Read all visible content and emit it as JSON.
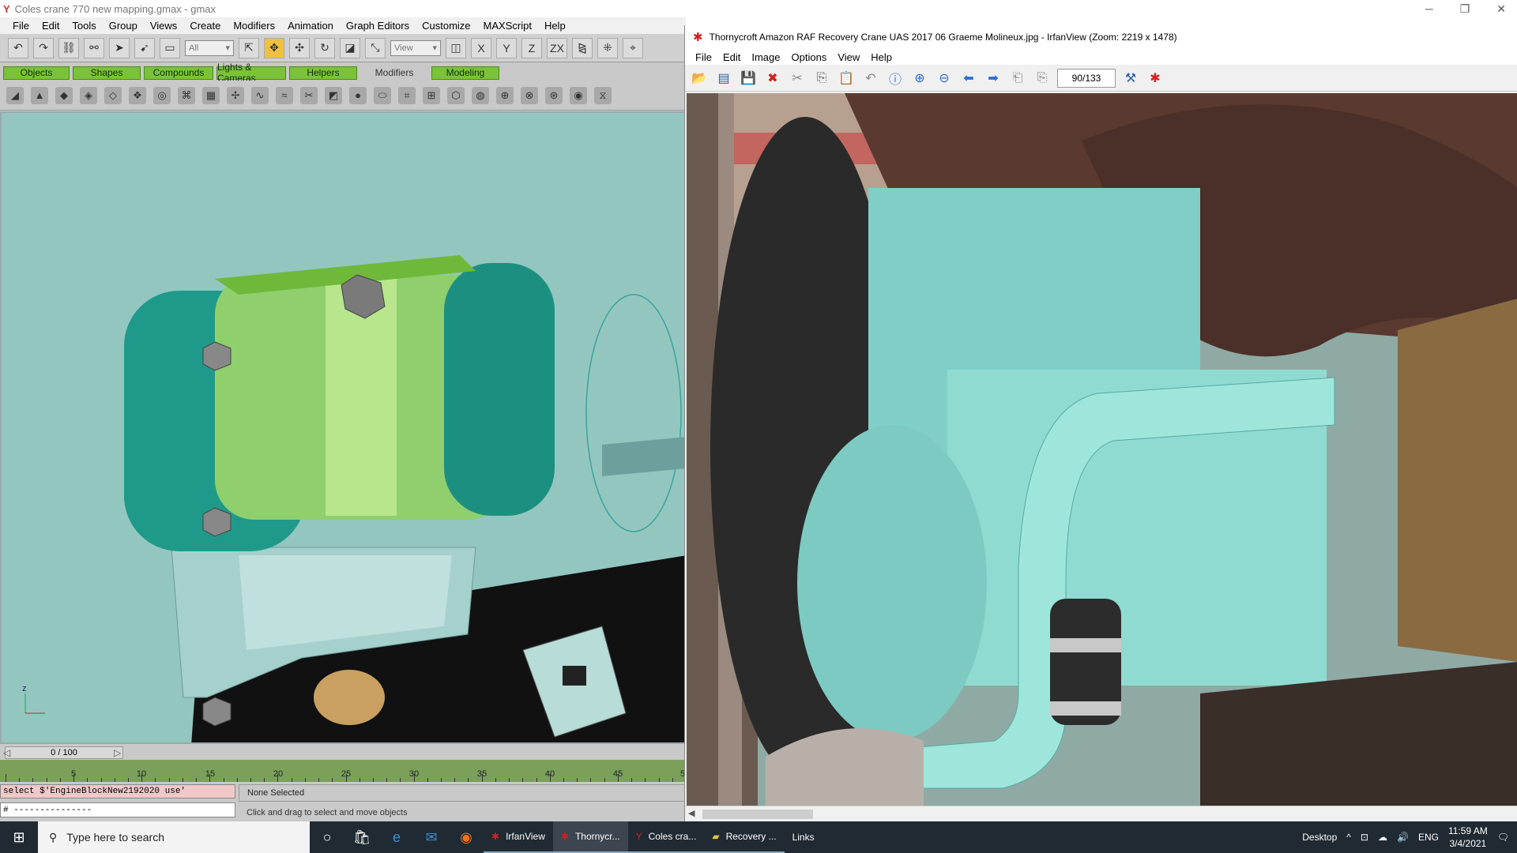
{
  "gmax": {
    "title": "Coles crane 770 new mapping.gmax - gmax",
    "menu": [
      "File",
      "Edit",
      "Tools",
      "Group",
      "Views",
      "Create",
      "Modifiers",
      "Animation",
      "Graph Editors",
      "Customize",
      "MAXScript",
      "Help"
    ],
    "selection_filter": "All",
    "ref_coord": "View",
    "tabs": [
      "Objects",
      "Shapes",
      "Compounds",
      "Lights & Cameras",
      "Helpers",
      "Modifiers",
      "Modeling"
    ],
    "selected_tab": "Modifiers",
    "time_slider": "0 / 100",
    "track_labels": [
      "5",
      "10",
      "15",
      "20",
      "25",
      "30",
      "35",
      "40",
      "45",
      "5"
    ],
    "script_line1": "select $'EngineBlockNew2192020 use'",
    "script_line2": "# ---------------",
    "status_selection": "None Selected",
    "status_prompt": "Click and drag to select and move objects"
  },
  "irfan": {
    "title": "Thornycroft Amazon RAF Recovery Crane UAS 2017 06 Graeme Molineux.jpg - IrfanView (Zoom: 2219 x 1478)",
    "menu": [
      "File",
      "Edit",
      "Image",
      "Options",
      "View",
      "Help"
    ],
    "page_counter": "90/133"
  },
  "taskbar": {
    "search_placeholder": "Type here to search",
    "apps": [
      {
        "label": "IrfanView",
        "active": false
      },
      {
        "label": "Thornycr...",
        "active": true
      },
      {
        "label": "Coles cra...",
        "active": false
      },
      {
        "label": "Recovery ...",
        "active": false
      }
    ],
    "links": "Links",
    "desktop": "Desktop",
    "language": "ENG",
    "time": "11:59 AM",
    "date": "3/4/2021"
  },
  "colors": {
    "viewport_bg": "#94c6c0",
    "tab_green": "#7bc23a",
    "taskbar_bg": "#1f2a33",
    "irfan_red": "#d42020"
  }
}
